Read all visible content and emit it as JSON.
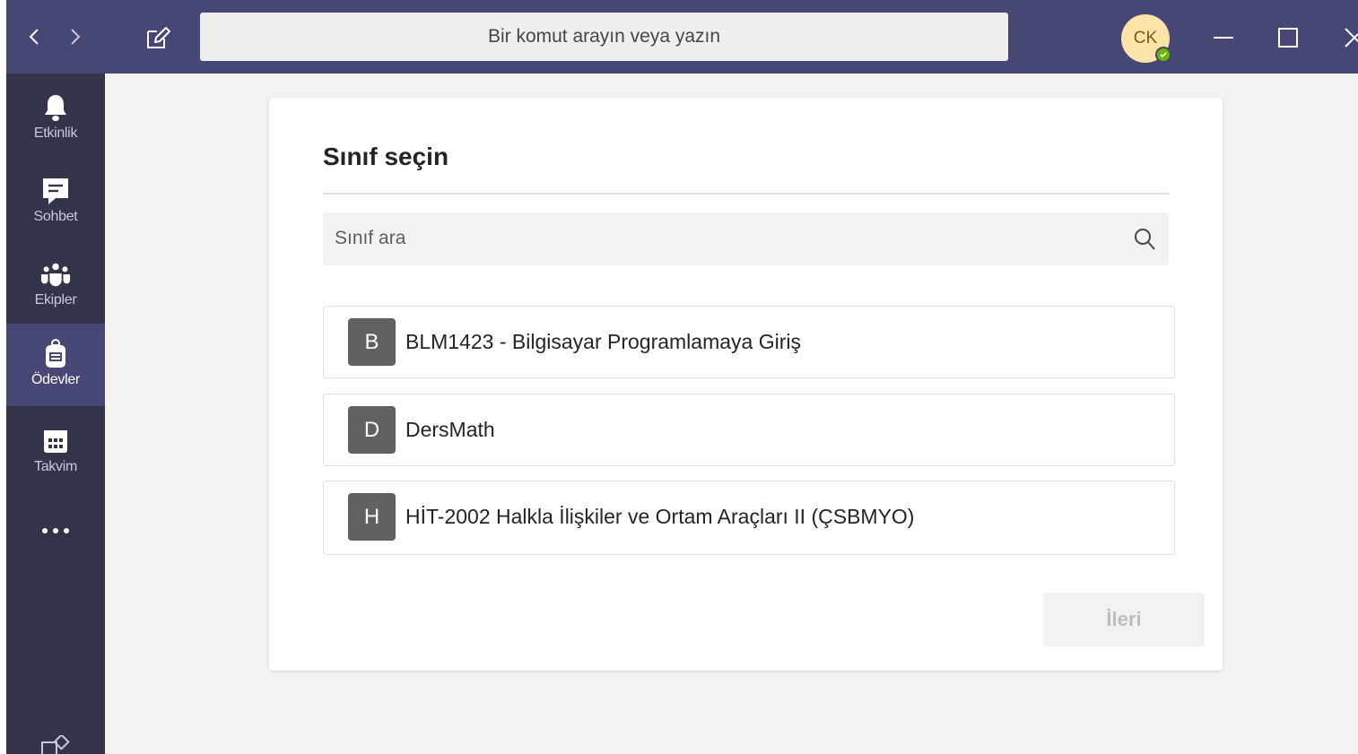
{
  "titlebar": {
    "search_placeholder": "Bir komut arayın veya yazın",
    "avatar_initials": "CK",
    "avatar_color": "#fce4a8",
    "presence_color": "#6bb700",
    "bg_color": "#464775"
  },
  "rail": {
    "items": [
      {
        "label": "Etkinlik",
        "icon": "bell-icon"
      },
      {
        "label": "Sohbet",
        "icon": "chat-icon"
      },
      {
        "label": "Ekipler",
        "icon": "teams-icon"
      },
      {
        "label": "Ödevler",
        "icon": "assignments-icon",
        "active": true
      },
      {
        "label": "Takvim",
        "icon": "calendar-icon"
      }
    ],
    "more_icon": "more-icon",
    "bottom_icon": "apps-icon"
  },
  "dialog": {
    "title": "Sınıf seçin",
    "search_placeholder": "Sınıf ara",
    "classes": [
      {
        "badge": "B",
        "name": "BLM1423 - Bilgisayar Programlamaya Giriş"
      },
      {
        "badge": "D",
        "name": "DersMath"
      },
      {
        "badge": "H",
        "name": "HİT-2002 Halkla İlişkiler ve Ortam Araçları II (ÇSBMYO)"
      }
    ],
    "next_label": "İleri",
    "next_enabled": false
  }
}
